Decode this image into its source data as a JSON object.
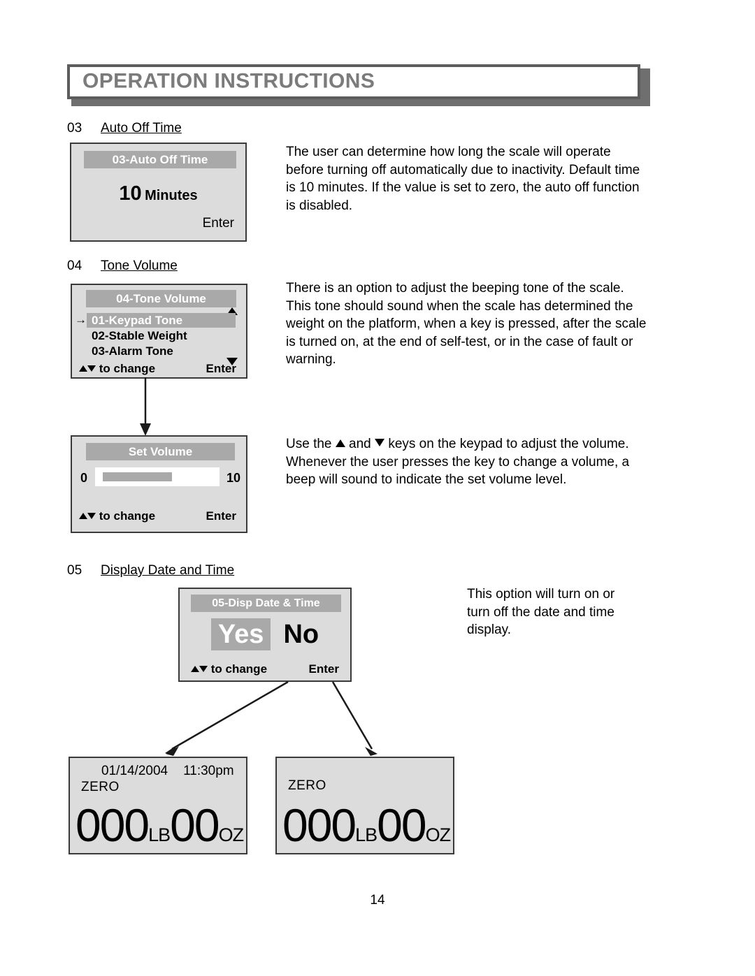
{
  "header": {
    "title": "OPERATION INSTRUCTIONS"
  },
  "sections": [
    {
      "number": "03",
      "title": "Auto Off Time",
      "paragraph": "The user can determine how long the scale will operate before turning off automatically due to inactivity. Default time is 10 minutes. If the value is set to zero, the auto off function is disabled.",
      "panel": {
        "title": "03-Auto Off Time",
        "value": "10",
        "unit": "Minutes",
        "enter_label": "Enter"
      }
    },
    {
      "number": "04",
      "title": "Tone Volume",
      "paragraph": "There is an option to adjust the beeping tone of the scale. This tone should sound when the scale has determined the weight on the platform, when a key is pressed, after the scale is turned on, at the end of self-test, or in the case of fault or warning.",
      "panel": {
        "title": "04-Tone Volume",
        "selector": "→",
        "items": [
          {
            "label": "01-Keypad Tone",
            "selected": true
          },
          {
            "label": "02-Stable Weight",
            "selected": false
          },
          {
            "label": "03-Alarm Tone",
            "selected": false
          }
        ],
        "footer_change": "to change",
        "footer_enter": "Enter"
      }
    }
  ],
  "volume": {
    "paragraph_line1_a": "Use the",
    "paragraph_line1_b": "and",
    "paragraph_line1_c": "keys on the keypad to adjust the volume.",
    "paragraph_line2": "Whenever the user presses the key to change a volume, a beep will sound to indicate the set volume level.",
    "panel": {
      "title": "Set Volume",
      "min": "0",
      "max": "10",
      "fill_percent": 62,
      "footer_change": "to change",
      "footer_enter": "Enter"
    }
  },
  "display_date_time": {
    "number": "05",
    "title": "Display Date and Time",
    "paragraph": "This option will turn on or turn off the date and time display.",
    "panel": {
      "title": "05-Disp Date & Time",
      "option_yes": "Yes",
      "option_no": "No",
      "selected_option": "Yes",
      "footer_change": "to change",
      "footer_enter": "Enter"
    }
  },
  "weight_displays": [
    {
      "date": "01/14/2004",
      "time": "11:30pm",
      "status": "ZERO",
      "pounds": "000",
      "pounds_unit": "LB",
      "ounces": "00",
      "ounces_unit": "OZ"
    },
    {
      "status": "ZERO",
      "pounds": "000",
      "pounds_unit": "LB",
      "ounces": "00",
      "ounces_unit": "OZ"
    }
  ],
  "footer": {
    "page_number": "14"
  },
  "colors": {
    "lcd_background": "#dcdcdc",
    "lcd_titlebar": "#a9a9a9",
    "header_text": "#7b7b7b",
    "border": "#3a3a3a"
  }
}
